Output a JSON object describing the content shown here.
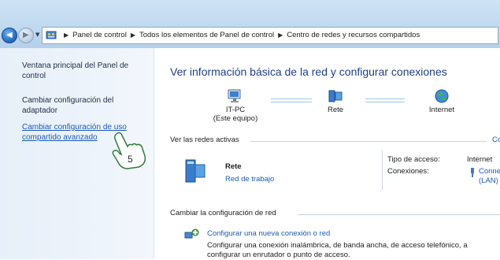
{
  "breadcrumb": [
    "Panel de control",
    "Todos los elementos de Panel de control",
    "Centro de redes y recursos compartidos"
  ],
  "sidebar": {
    "items": [
      {
        "label": "Ventana principal del Panel de control"
      },
      {
        "label": "Cambiar configuración del adaptador"
      },
      {
        "label": "Cambiar configuración de uso compartido avanzado"
      }
    ]
  },
  "main": {
    "title": "Ver información básica de la red y configurar conexiones",
    "nodes": [
      {
        "label": "IT-PC",
        "sub": "(Este equipo)"
      },
      {
        "label": "Rete"
      },
      {
        "label": "Internet"
      }
    ],
    "active_networks_header": "Ver las redes activas",
    "active_networks_link": "Co",
    "network": {
      "name": "Rete",
      "type": "Red de trabajo",
      "access_label": "Tipo de acceso:",
      "access_value": "Internet",
      "connections_label": "Conexiones:",
      "connections_value": "Connessi",
      "connections_value2": "(LAN)"
    },
    "change_header": "Cambiar la configuración de red",
    "new_connection_link": "Configurar una nueva conexión o red",
    "new_connection_desc1": "Configurar una conexión inalámbrica, de banda ancha, de acceso telefónico, a",
    "new_connection_desc2": "configurar un enrutador o punto de acceso."
  },
  "step_badge": "5"
}
